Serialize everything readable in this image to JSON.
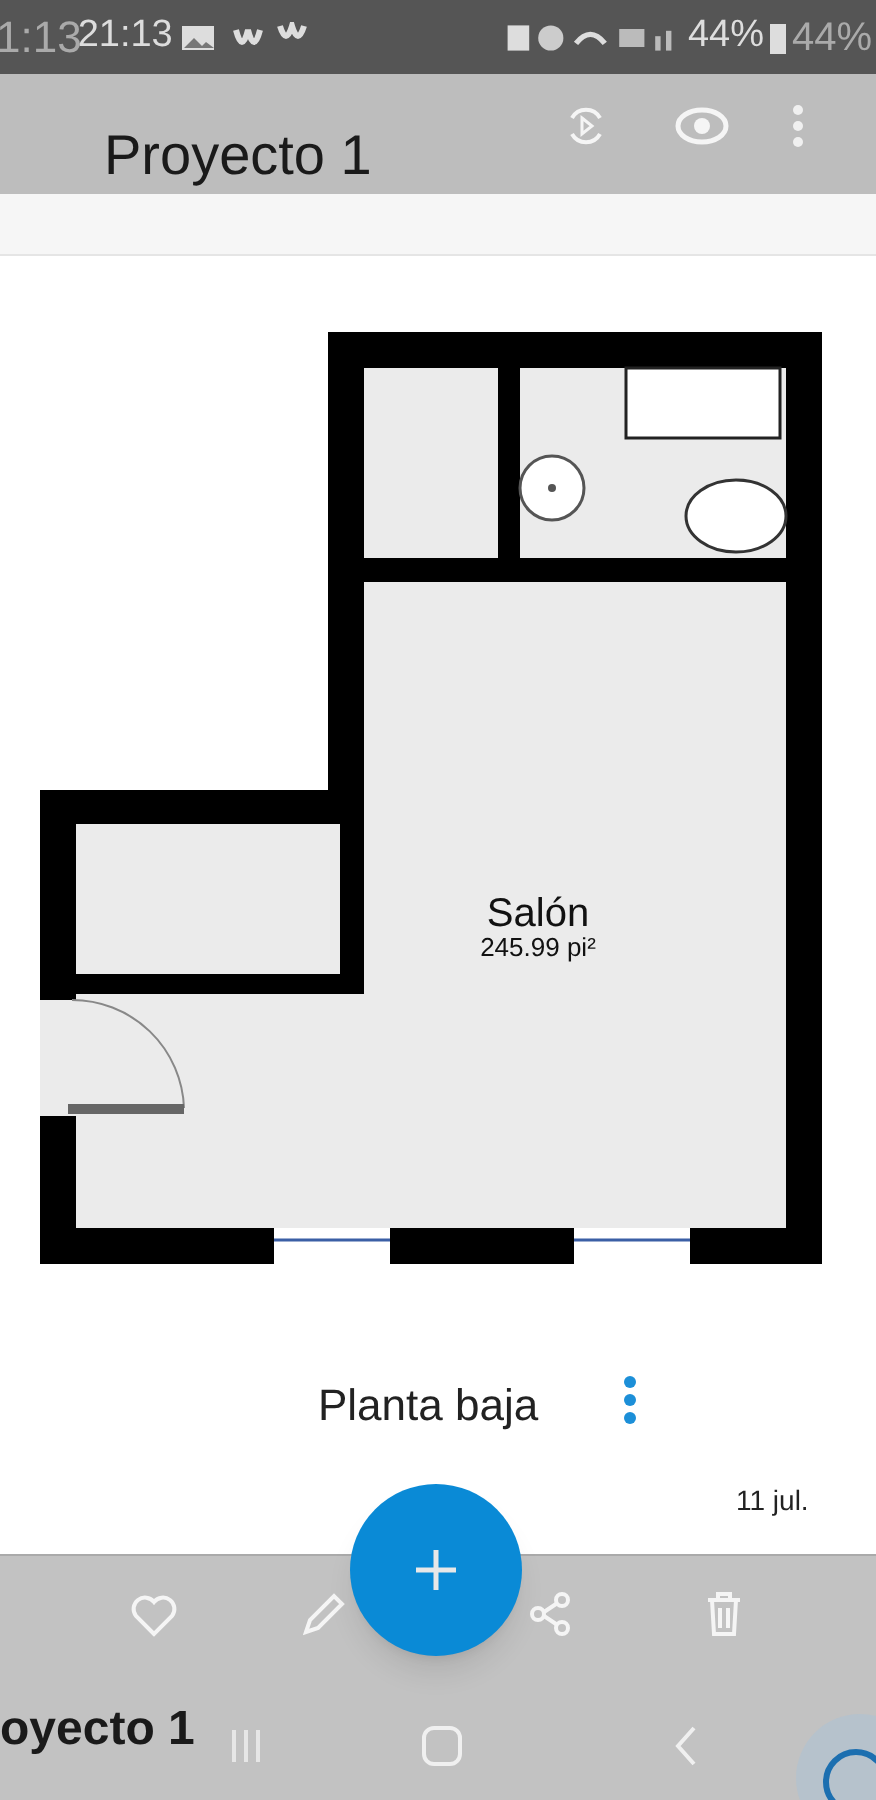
{
  "status_bar": {
    "ghost_time": "1:13",
    "time": "21:13",
    "battery": "44%",
    "ghost_battery": "44%"
  },
  "app_bar": {
    "title": "Proyecto 1"
  },
  "floor_plan": {
    "room_name": "Salón",
    "room_area": "245.99 pi²"
  },
  "floor": {
    "name": "Planta baja",
    "date": "11 jul."
  },
  "overlay_title": "oyecto 1"
}
